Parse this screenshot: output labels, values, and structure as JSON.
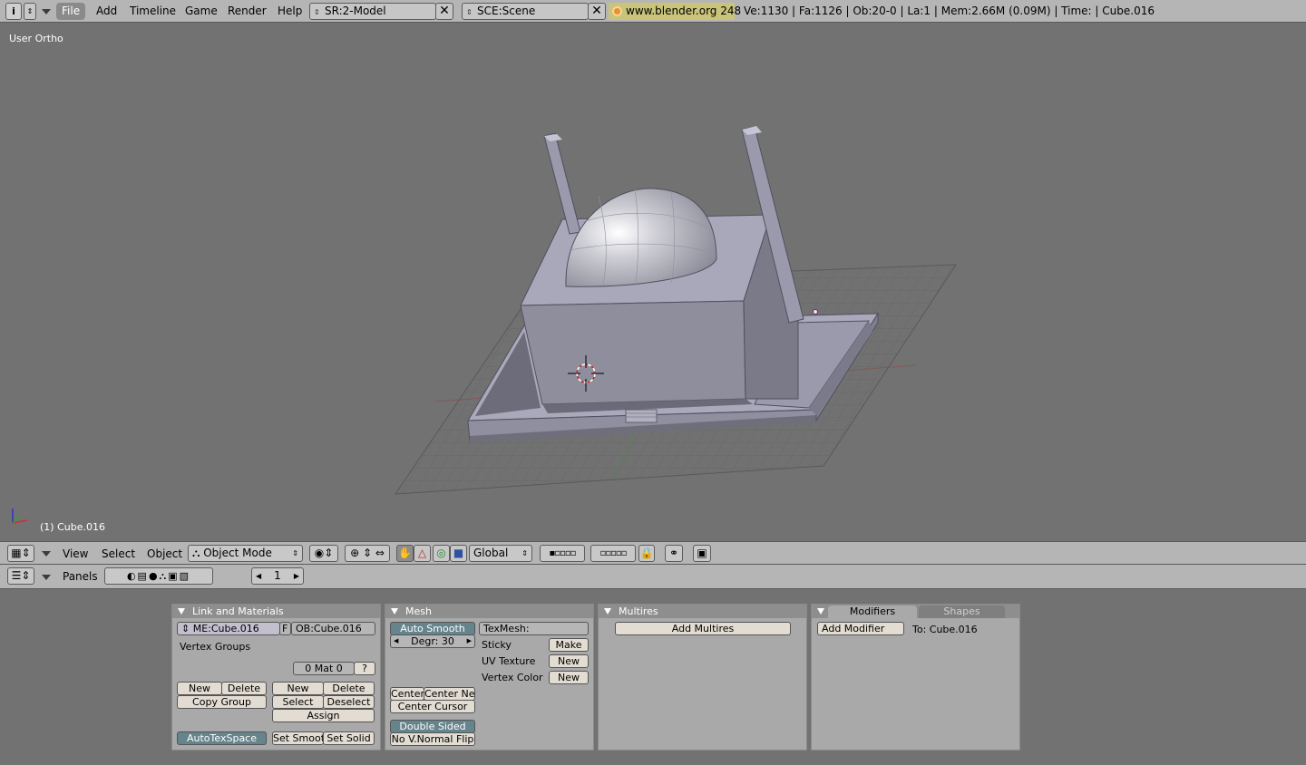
{
  "top_menu": {
    "info_icon": "info-icon",
    "items": [
      "File",
      "Add",
      "Timeline",
      "Game",
      "Render",
      "Help"
    ],
    "screen": "SR:2-Model",
    "scene": "SCE:Scene",
    "website": "www.blender.org 248",
    "stats": "Ve:1130 | Fa:1126 | Ob:20-0 | La:1  | Mem:2.66M (0.09M)  | Time: | Cube.016"
  },
  "viewport": {
    "view_label": "User Ortho",
    "object_label": "(1) Cube.016"
  },
  "view_header": {
    "menus": [
      "View",
      "Select",
      "Object"
    ],
    "mode": "Object Mode",
    "orientation": "Global"
  },
  "buttons_header": {
    "panels_label": "Panels",
    "frame": "1"
  },
  "link_materials": {
    "title": "Link and Materials",
    "mesh_name": "ME:Cube.016",
    "f_label": "F",
    "object_name": "OB:Cube.016",
    "vertex_groups": "Vertex Groups",
    "mat_field": "0 Mat 0",
    "mat_q": "?",
    "vg_new": "New",
    "vg_delete": "Delete",
    "copy_group": "Copy Group",
    "mat_new": "New",
    "mat_delete": "Delete",
    "mat_select": "Select",
    "mat_deselect": "Deselect",
    "assign": "Assign",
    "autotexspace": "AutoTexSpace",
    "set_smooth": "Set Smoot",
    "set_solid": "Set Solid"
  },
  "mesh": {
    "title": "Mesh",
    "auto_smooth": "Auto Smooth",
    "degr": "Degr: 30",
    "texmesh": "TexMesh:",
    "sticky": "Sticky",
    "sticky_btn": "Make",
    "uv_texture": "UV Texture",
    "uv_btn": "New",
    "vertex_color": "Vertex Color",
    "vc_btn": "New",
    "center": "Center",
    "center_new": "Center Ne",
    "center_cursor": "Center Cursor",
    "double_sided": "Double Sided",
    "no_vnormal_flip": "No V.Normal Flip"
  },
  "multires": {
    "title": "Multires",
    "add_btn": "Add Multires"
  },
  "modifiers": {
    "tab_modifiers": "Modifiers",
    "tab_shapes": "Shapes",
    "add_btn": "Add Modifier",
    "to_label": "To: Cube.016"
  },
  "colors": {
    "header_bg": "#b5b5b5",
    "viewport_bg": "#727272",
    "mesh_face": "#a8a8b8",
    "accent_teal": "#66848c"
  }
}
